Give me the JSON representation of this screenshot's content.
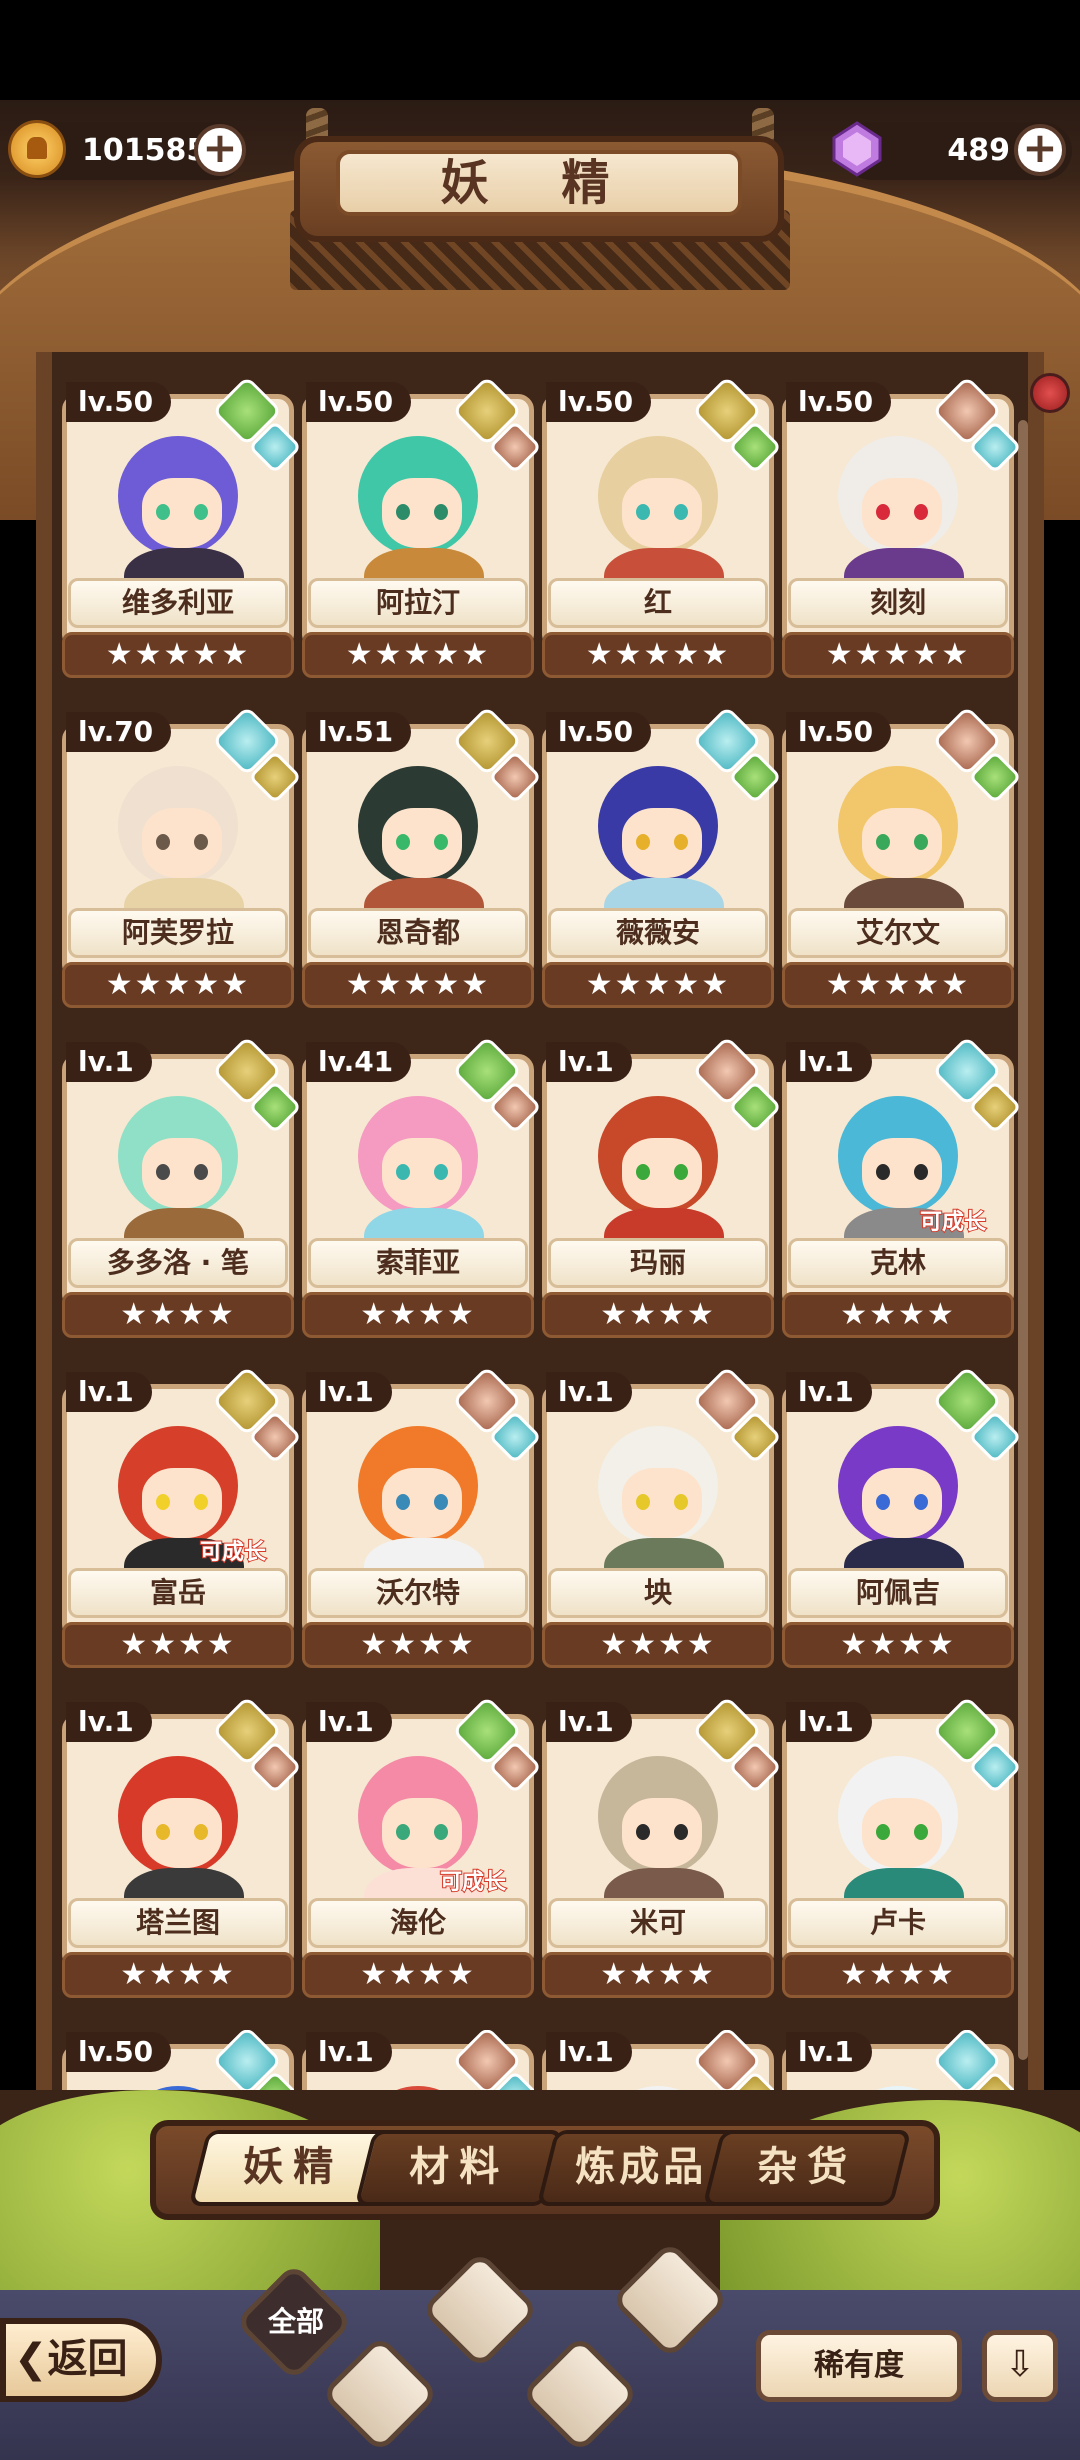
{
  "header": {
    "title": "妖 精",
    "coins": "101585",
    "gems": "489",
    "plus_symbol": "+"
  },
  "colors": {
    "grass": "#6cbf3f",
    "earth": "#c9a93b",
    "water": "#5cc6cf",
    "rock": "#b4735a"
  },
  "fairies": [
    {
      "level": "lv.50",
      "name": "维多利亚",
      "stars": "★★★★★",
      "element": "grass",
      "element2": "water",
      "hair": "#6e5cd6",
      "eyes": "#3fbf8a",
      "outfit": "#3a3046",
      "grow": ""
    },
    {
      "level": "lv.50",
      "name": "阿拉汀",
      "stars": "★★★★★",
      "element": "earth",
      "element2": "rock",
      "hair": "#3fc7a8",
      "eyes": "#2c8c6a",
      "outfit": "#c88a3a",
      "grow": ""
    },
    {
      "level": "lv.50",
      "name": "红",
      "stars": "★★★★★",
      "element": "earth",
      "element2": "grass",
      "hair": "#e7cf9f",
      "eyes": "#3bb8b0",
      "outfit": "#c8503a",
      "grow": ""
    },
    {
      "level": "lv.50",
      "name": "刻刻",
      "stars": "★★★★★",
      "element": "rock",
      "element2": "water",
      "hair": "#f0ece8",
      "eyes": "#d82a3a",
      "outfit": "#6a3a8c",
      "grow": ""
    },
    {
      "level": "lv.70",
      "name": "阿芙罗拉",
      "stars": "★★★★★",
      "element": "water",
      "element2": "earth",
      "hair": "#efe0cf",
      "eyes": "#6b5a4a",
      "outfit": "#e8d3a6",
      "grow": ""
    },
    {
      "level": "lv.51",
      "name": "恩奇都",
      "stars": "★★★★★",
      "element": "earth",
      "element2": "rock",
      "hair": "#2c3a34",
      "eyes": "#3ab86a",
      "outfit": "#b2563a",
      "grow": ""
    },
    {
      "level": "lv.50",
      "name": "薇薇安",
      "stars": "★★★★★",
      "element": "water",
      "element2": "grass",
      "hair": "#3a3aa6",
      "eyes": "#e6b02a",
      "outfit": "#a8d6e6",
      "grow": ""
    },
    {
      "level": "lv.50",
      "name": "艾尔文",
      "stars": "★★★★★",
      "element": "rock",
      "element2": "grass",
      "hair": "#f2c66a",
      "eyes": "#3aa85a",
      "outfit": "#6a4a3a",
      "grow": ""
    },
    {
      "level": "lv.1",
      "name": "多多洛 · 笔",
      "stars": "★★★★",
      "element": "earth",
      "element2": "grass",
      "hair": "#8fe0c6",
      "eyes": "#4a4a4a",
      "outfit": "#9a6a3a",
      "grow": ""
    },
    {
      "level": "lv.41",
      "name": "索菲亚",
      "stars": "★★★★",
      "element": "grass",
      "element2": "rock",
      "hair": "#f59ac0",
      "eyes": "#3ab8b0",
      "outfit": "#8fd6e6",
      "grow": ""
    },
    {
      "level": "lv.1",
      "name": "玛丽",
      "stars": "★★★★",
      "element": "rock",
      "element2": "grass",
      "hair": "#c8482a",
      "eyes": "#3aa83a",
      "outfit": "#c83a2a",
      "grow": ""
    },
    {
      "level": "lv.1",
      "name": "克林",
      "stars": "★★★★",
      "element": "water",
      "element2": "earth",
      "hair": "#4ab8d6",
      "eyes": "#2a2a2a",
      "outfit": "#8a8a8a",
      "grow": "可成长"
    },
    {
      "level": "lv.1",
      "name": "富岳",
      "stars": "★★★★",
      "element": "earth",
      "element2": "rock",
      "hair": "#d6402a",
      "eyes": "#f2d02a",
      "outfit": "#2a2a2a",
      "grow": "可成长"
    },
    {
      "level": "lv.1",
      "name": "沃尔特",
      "stars": "★★★★",
      "element": "rock",
      "element2": "water",
      "hair": "#f07a2a",
      "eyes": "#3a8ab8",
      "outfit": "#f2f2f2",
      "grow": ""
    },
    {
      "level": "lv.1",
      "name": "坱",
      "stars": "★★★★",
      "element": "rock",
      "element2": "earth",
      "hair": "#f2f0e8",
      "eyes": "#e6c82a",
      "outfit": "#6a7a5a",
      "grow": ""
    },
    {
      "level": "lv.1",
      "name": "阿佩吉",
      "stars": "★★★★",
      "element": "grass",
      "element2": "water",
      "hair": "#7a3ac8",
      "eyes": "#3a6ad6",
      "outfit": "#2a2a4a",
      "grow": ""
    },
    {
      "level": "lv.1",
      "name": "塔兰图",
      "stars": "★★★★",
      "element": "earth",
      "element2": "rock",
      "hair": "#d83a2a",
      "eyes": "#e6b82a",
      "outfit": "#3a3a3a",
      "grow": ""
    },
    {
      "level": "lv.1",
      "name": "海伦",
      "stars": "★★★★",
      "element": "grass",
      "element2": "rock",
      "hair": "#f48aa6",
      "eyes": "#3aa87a",
      "outfit": "#fce0d6",
      "grow": "可成长"
    },
    {
      "level": "lv.1",
      "name": "米可",
      "stars": "★★★★",
      "element": "earth",
      "element2": "rock",
      "hair": "#c6b69a",
      "eyes": "#2a2a2a",
      "outfit": "#7a5a4a",
      "grow": ""
    },
    {
      "level": "lv.1",
      "name": "卢卡",
      "stars": "★★★★",
      "element": "grass",
      "element2": "water",
      "hair": "#f2f2f2",
      "eyes": "#3aa83a",
      "outfit": "#2a8a7a",
      "grow": ""
    }
  ],
  "partial_row": [
    {
      "level": "lv.50",
      "element": "water",
      "element2": "grass",
      "hair": "#3a6ad6"
    },
    {
      "level": "lv.1",
      "element": "rock",
      "element2": "water",
      "hair": "#d84a3a"
    },
    {
      "level": "lv.1",
      "element": "rock",
      "element2": "earth",
      "hair": "#f2f2f2"
    },
    {
      "level": "lv.1",
      "element": "water",
      "element2": "earth",
      "hair": "#e8f4f8"
    }
  ],
  "tabs": [
    "妖精",
    "材料",
    "炼成品",
    "杂货"
  ],
  "active_tab": 0,
  "filters": {
    "all_label": "全部",
    "icons": [
      "grass-filter-icon",
      "water-filter-icon",
      "rock-filter-icon",
      "mountain-filter-icon"
    ]
  },
  "nav": {
    "back_label": "返回",
    "sort_label": "稀有度",
    "order_symbol": "⇩"
  }
}
